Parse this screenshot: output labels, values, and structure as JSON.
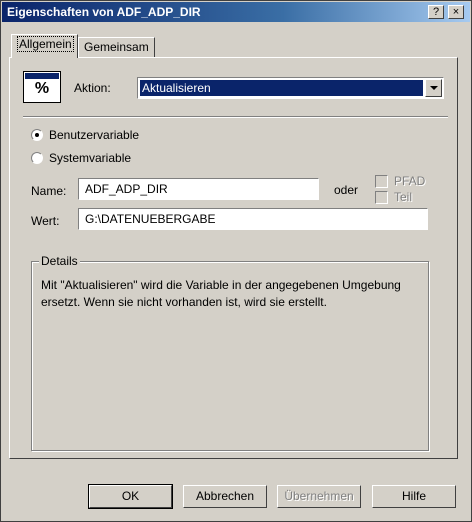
{
  "window": {
    "title": "Eigenschaften von ADF_ADP_DIR",
    "help_glyph": "?",
    "close_glyph": "×"
  },
  "tabs": [
    {
      "label": "Allgemein",
      "active": true
    },
    {
      "label": "Gemeinsam",
      "active": false
    }
  ],
  "action": {
    "icon": "percent-variable-icon",
    "icon_text": "%",
    "label": "Aktion:",
    "selected": "Aktualisieren"
  },
  "variable_type": {
    "options": [
      {
        "label": "Benutzervariable",
        "checked": true
      },
      {
        "label": "Systemvariable",
        "checked": false
      }
    ]
  },
  "name": {
    "label": "Name:",
    "value": "ADF_ADP_DIR",
    "oder_label": "oder",
    "checkboxes": [
      {
        "label": "PFAD",
        "checked": false,
        "enabled": false
      },
      {
        "label": "Teil",
        "checked": false,
        "enabled": false
      }
    ]
  },
  "value": {
    "label": "Wert:",
    "value": "G:\\DATENUEBERGABE"
  },
  "details": {
    "legend": "Details",
    "text": "Mit \"Aktualisieren\" wird die Variable in der angegebenen Umgebung ersetzt. Wenn sie nicht vorhanden ist, wird sie erstellt."
  },
  "buttons": {
    "ok": "OK",
    "cancel": "Abbrechen",
    "apply": "Übernehmen",
    "help": "Hilfe"
  }
}
